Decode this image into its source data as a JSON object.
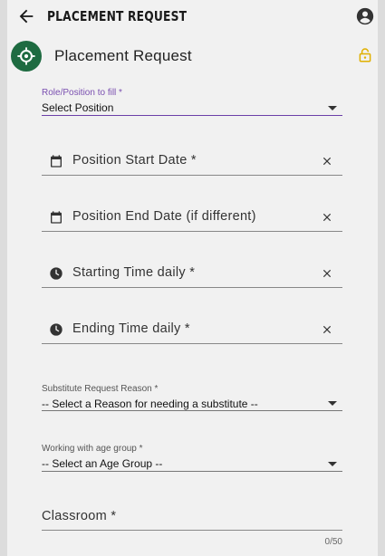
{
  "appbar": {
    "title": "PLACEMENT REQUEST",
    "back_icon": "arrow-left-icon",
    "account_icon": "account-circle-icon"
  },
  "header": {
    "title": "Placement Request",
    "badge_icon": "crosshair-icon",
    "lock_icon": "lock-open-icon",
    "badge_color": "#1e6b41",
    "lock_color": "#e0b000"
  },
  "form": {
    "role": {
      "label": "Role/Position to fill *",
      "value": "Select Position"
    },
    "start_date": {
      "label": "Position Start Date *"
    },
    "end_date": {
      "label": "Position End Date (if different)"
    },
    "start_time": {
      "label": "Starting Time daily *"
    },
    "end_time": {
      "label": "Ending Time daily *"
    },
    "reason": {
      "label": "Substitute Request Reason *",
      "value": "-- Select a Reason for needing a substitute --"
    },
    "age_group": {
      "label": "Working with age group *",
      "value": "-- Select an Age Group --"
    },
    "classroom": {
      "label": "Classroom *",
      "counter": "0/50"
    }
  },
  "colors": {
    "accent": "#6b3fa8",
    "background": "#f1f1f1"
  }
}
